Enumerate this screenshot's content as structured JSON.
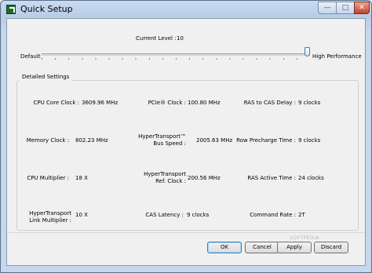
{
  "window": {
    "title": "Quick Setup"
  },
  "titlebar": {
    "minimize_glyph": "—",
    "maximize_glyph": "□",
    "close_glyph": "✕"
  },
  "current_level": {
    "label": "Current Level :",
    "value": "10"
  },
  "slider": {
    "left_label": "Default",
    "right_label": "High Performance",
    "level": 10,
    "max": 10
  },
  "detailed": {
    "title": "Detailed Settings",
    "items": [
      {
        "label": "CPU Core Clock :",
        "value": "3609.96 MHz"
      },
      {
        "label": "PCIe® Clock :",
        "value": "100.80 MHz"
      },
      {
        "label": "RAS to CAS Delay :",
        "value": "9 clocks"
      },
      {
        "label": "Memory Clock :",
        "value": "802.23 MHz"
      },
      {
        "label": "HyperTransport™\nBus Speed :",
        "value": "2005.63 MHz"
      },
      {
        "label": "Row Precharge Time :",
        "value": "9 clocks"
      },
      {
        "label": "CPU Multiplier :",
        "value": "18 X"
      },
      {
        "label": "HyperTransport\nRef. Clock :",
        "value": "200.56 MHz"
      },
      {
        "label": "RAS Active Time :",
        "value": "24 clocks"
      },
      {
        "label": "HyperTransport\nLink Multiplier :",
        "value": "10 X"
      },
      {
        "label": "CAS Latency :",
        "value": "9 clocks"
      },
      {
        "label": "Command Rate :",
        "value": "2T"
      }
    ]
  },
  "buttons": {
    "ok": "OK",
    "cancel": "Cancel",
    "apply": "Apply",
    "discard": "Discard"
  },
  "watermark": "SOFTPEDIA"
}
